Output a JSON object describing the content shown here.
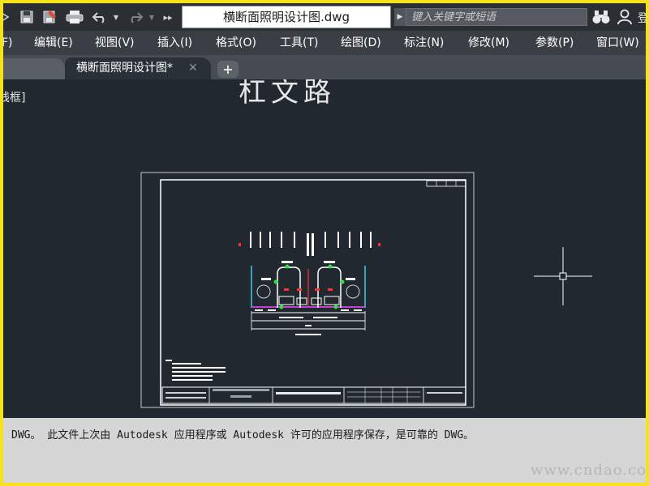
{
  "window": {
    "title": "横断面照明设计图.dwg",
    "login_label": "登"
  },
  "search": {
    "placeholder": "键入关键字或短语"
  },
  "menu": [
    {
      "label": "F)"
    },
    {
      "label": "编辑(E)"
    },
    {
      "label": "视图(V)"
    },
    {
      "label": "插入(I)"
    },
    {
      "label": "格式(O)"
    },
    {
      "label": "工具(T)"
    },
    {
      "label": "绘图(D)"
    },
    {
      "label": "标注(N)"
    },
    {
      "label": "修改(M)"
    },
    {
      "label": "参数(P)"
    },
    {
      "label": "窗口(W)"
    }
  ],
  "tabs": {
    "active_label": "横断面照明设计图*",
    "close_glyph": "✕",
    "add_glyph": "+"
  },
  "canvas": {
    "viewport_label": "线框]",
    "drawing_heading": "杠文路"
  },
  "command_line": {
    "message": "DWG。  此文件上次由 Autodesk 应用程序或 Autodesk 许可的应用程序保存，是可靠的 DWG。"
  },
  "watermark": "www.cndao.com",
  "icons": [
    "arrow-icon",
    "save-icon",
    "saveas-icon",
    "print-icon",
    "undo-icon",
    "redo-icon",
    "more-icon",
    "binoculars-icon",
    "user-icon",
    "close-icon",
    "plus-icon",
    "crosshair-icon"
  ],
  "colors": {
    "canvas_bg": "#212830",
    "title_bar": "#2b2e33",
    "menu_bar": "#3a3e45",
    "outer_border": "#f5e21a"
  }
}
